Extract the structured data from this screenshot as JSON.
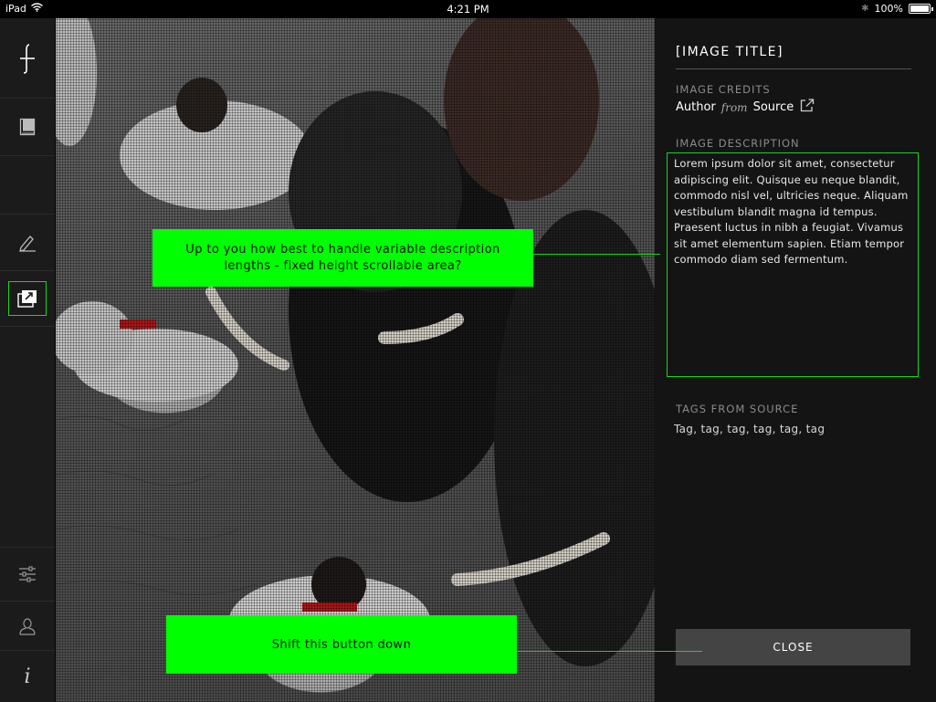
{
  "status_bar": {
    "device": "iPad",
    "time": "4:21 PM",
    "battery": "100%",
    "battery_level": 1.0
  },
  "nav": {
    "items": [
      {
        "icon": "logo-icon"
      },
      {
        "icon": "book-icon"
      },
      {
        "icon": "blank"
      },
      {
        "icon": "pen-icon"
      },
      {
        "icon": "image-gallery-icon",
        "active": true
      },
      {
        "icon": "sliders-icon"
      },
      {
        "icon": "user-icon"
      },
      {
        "icon": "info-icon"
      }
    ]
  },
  "annotations": {
    "description_note": "Up to you how best to handle variable description lengths - fixed height scrollable area?",
    "button_note": "Shift this button down"
  },
  "panel": {
    "title": "[IMAGE TITLE]",
    "credits_label": "IMAGE CREDITS",
    "credits_author": "Author",
    "credits_from": "from",
    "credits_source": "Source",
    "description_label": "IMAGE DESCRIPTION",
    "description_text": "Lorem ipsum dolor sit amet, consectetur adipiscing elit. Quisque eu neque blandit, commodo nisl vel, ultricies neque. Aliquam vestibulum blandit magna id tempus. Praesent luctus in nibh a feugiat. Vivamus sit amet elementum sapien. Etiam tempor commodo diam sed fermentum.",
    "tags_label": "TAGS FROM SOURCE",
    "tags_text": "Tag, tag, tag, tag, tag, tag",
    "close_label": "CLOSE"
  },
  "colors": {
    "annotation_green": "#00ff00",
    "highlight_border": "#1ed21e",
    "panel_bg": "#141414",
    "nav_bg": "#1b1b1b",
    "button_bg": "#444444"
  }
}
